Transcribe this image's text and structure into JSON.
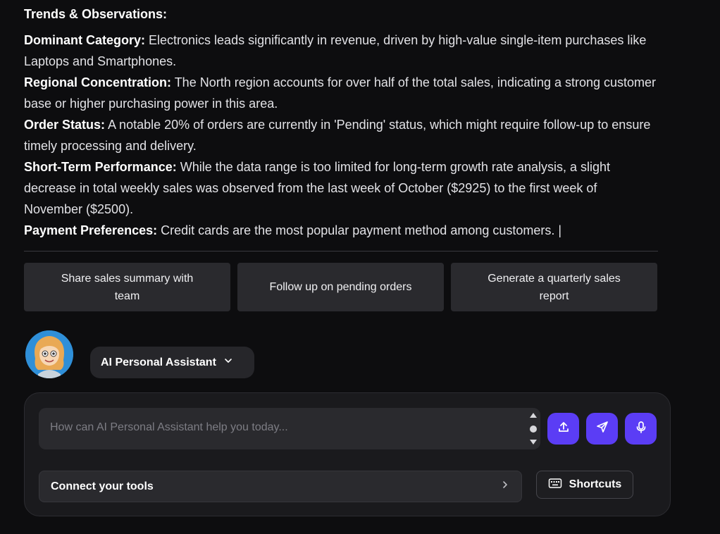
{
  "content": {
    "heading": "Trends & Observations:",
    "observations": [
      {
        "label": "Dominant Category:",
        "text": " Electronics leads significantly in revenue, driven by high-value single-item purchases like Laptops and Smartphones."
      },
      {
        "label": "Regional Concentration:",
        "text": " The North region accounts for over half of the total sales, indicating a strong customer base or higher purchasing power in this area."
      },
      {
        "label": "Order Status:",
        "text": " A notable 20% of orders are currently in 'Pending' status, which might require follow-up to ensure timely processing and delivery."
      },
      {
        "label": "Short-Term Performance:",
        "text": " While the data range is too limited for long-term growth rate analysis, a slight decrease in total weekly sales was observed from the last week of October ($2925) to the first week of November ($2500)."
      },
      {
        "label": "Payment Preferences:",
        "text": " Credit cards are the most popular payment method among customers. |"
      }
    ]
  },
  "suggestions": [
    "Share sales summary with team",
    "Follow up on pending orders",
    "Generate a quarterly sales report"
  ],
  "assistant": {
    "name": "AI Personal Assistant"
  },
  "composer": {
    "placeholder": "How can AI Personal Assistant help you today...",
    "value": "",
    "connect_label": "Connect your tools",
    "shortcuts_label": "Shortcuts"
  },
  "icons": {
    "upload": "upload-icon",
    "send": "send-icon",
    "mic": "microphone-icon",
    "chevron_down": "chevron-down-icon",
    "chevron_right": "chevron-right-icon",
    "keyboard": "keyboard-icon"
  },
  "colors": {
    "accent": "#5b3df5",
    "background": "#0d0d0f",
    "surface": "#2a2a2e"
  }
}
